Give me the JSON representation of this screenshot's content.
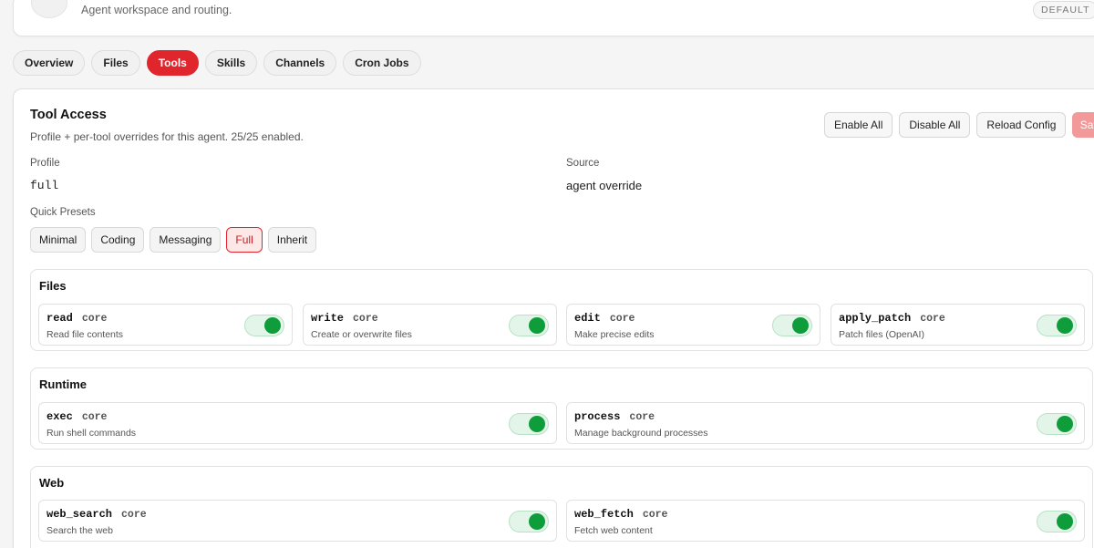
{
  "header": {
    "subtitle": "Agent workspace and routing.",
    "badge": "DEFAULT"
  },
  "tabs": [
    {
      "label": "Overview"
    },
    {
      "label": "Files"
    },
    {
      "label": "Tools",
      "active": true
    },
    {
      "label": "Skills"
    },
    {
      "label": "Channels"
    },
    {
      "label": "Cron Jobs"
    }
  ],
  "tool_access": {
    "title": "Tool Access",
    "subtitle": "Profile + per-tool overrides for this agent. 25/25 enabled.",
    "actions": {
      "enable_all": "Enable All",
      "disable_all": "Disable All",
      "reload_config": "Reload Config",
      "save": "Save"
    },
    "profile_label": "Profile",
    "profile_value": "full",
    "source_label": "Source",
    "source_value": "agent override",
    "presets_label": "Quick Presets",
    "presets": [
      "Minimal",
      "Coding",
      "Messaging",
      "Full",
      "Inherit"
    ],
    "active_preset": "Full"
  },
  "groups": [
    {
      "title": "Files",
      "tools": [
        {
          "name": "read",
          "badge": "core",
          "desc": "Read file contents",
          "enabled": true
        },
        {
          "name": "write",
          "badge": "core",
          "desc": "Create or overwrite files",
          "enabled": true
        },
        {
          "name": "edit",
          "badge": "core",
          "desc": "Make precise edits",
          "enabled": true
        },
        {
          "name": "apply_patch",
          "badge": "core",
          "desc": "Patch files (OpenAI)",
          "enabled": true
        }
      ]
    },
    {
      "title": "Runtime",
      "tools": [
        {
          "name": "exec",
          "badge": "core",
          "desc": "Run shell commands",
          "enabled": true
        },
        {
          "name": "process",
          "badge": "core",
          "desc": "Manage background processes",
          "enabled": true
        }
      ]
    },
    {
      "title": "Web",
      "tools": [
        {
          "name": "web_search",
          "badge": "core",
          "desc": "Search the web",
          "enabled": true
        },
        {
          "name": "web_fetch",
          "badge": "core",
          "desc": "Fetch web content",
          "enabled": true
        }
      ]
    }
  ],
  "colors": {
    "accent": "#e0262c",
    "toggle_on": "#0f9d3c"
  }
}
